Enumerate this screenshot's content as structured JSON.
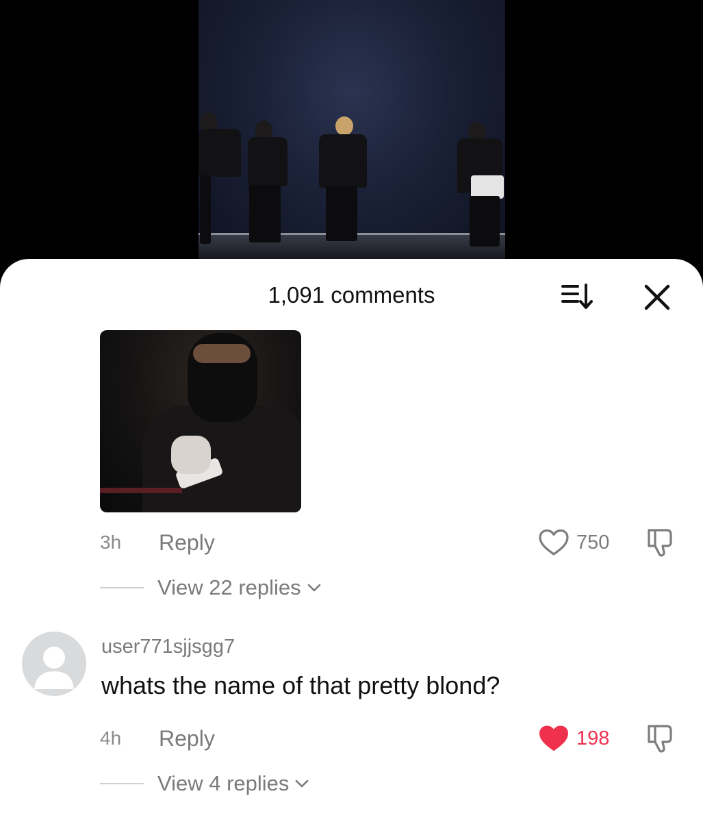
{
  "video": {
    "description": ""
  },
  "comments_header": {
    "title": "1,091 comments"
  },
  "comments": [
    {
      "type": "sticker",
      "time": "3h",
      "reply_label": "Reply",
      "likes": "750",
      "liked": false,
      "view_replies": "View 22 replies"
    },
    {
      "type": "text",
      "username": "user771sjjsgg7",
      "text": "whats the name of that pretty blond?",
      "time": "4h",
      "reply_label": "Reply",
      "likes": "198",
      "liked": true,
      "view_replies": "View 4 replies"
    }
  ],
  "colors": {
    "like_active": "#f0314e",
    "muted_text": "#7a7a7a"
  },
  "icons": [
    "sort-icon",
    "close-icon",
    "heart-icon",
    "dislike-icon",
    "chevron-down-icon",
    "default-avatar-icon"
  ]
}
